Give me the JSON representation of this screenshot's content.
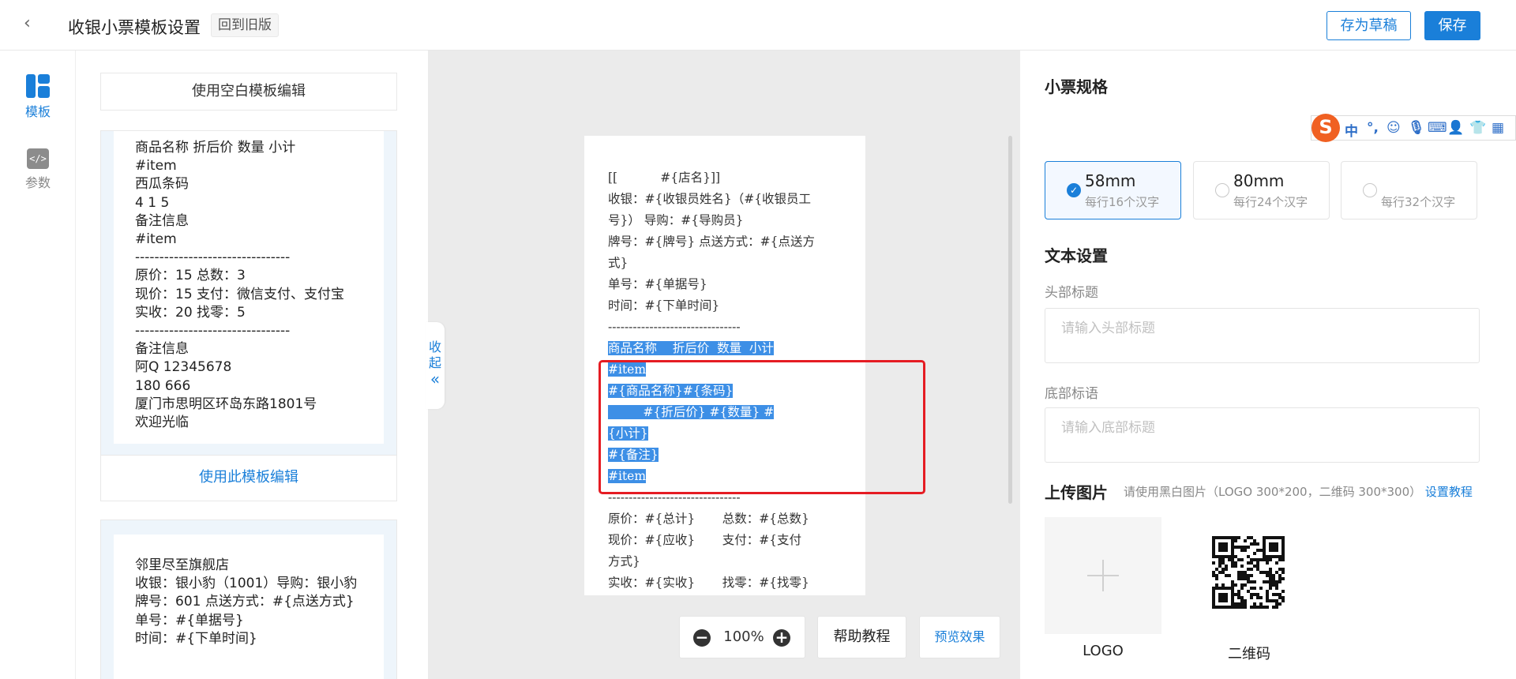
{
  "topbar": {
    "back_icon": "chevron-left-icon",
    "title": "收银小票模板设置",
    "old_version": "回到旧版",
    "draft_button": "存为草稿",
    "save_button": "保存"
  },
  "nav": {
    "templates": {
      "label": "模板",
      "icon": "grid-icon"
    },
    "params": {
      "label": "参数",
      "icon": "code-icon"
    }
  },
  "templates": {
    "blank_button": "使用空白模板编辑",
    "card1_lines": [
      "商品名称 折后价 数量 小计",
      "#item",
      "西瓜条码",
      "4 1 5",
      "备注信息",
      "#item",
      "--------------------------------",
      "原价：15 总数：3",
      "现价：15 支付：微信支付、支付宝",
      "实收：20 找零：5",
      "--------------------------------",
      "备注信息",
      "阿Q 12345678",
      "180 666",
      "厦门市思明区环岛东路1801号",
      "欢迎光临"
    ],
    "use_button": "使用此模板编辑",
    "card2_lines": [
      "邻里尽至旗舰店",
      "收银：银小豹（1001）导购：银小豹",
      "牌号：601 点送方式：#{点送方式}",
      "单号：#{单据号}",
      "时间：#{下单时间}"
    ]
  },
  "preview": {
    "collapse_label": "收起",
    "receipt_lines": [
      {
        "text": "[[           #{店名}]]",
        "hl": false
      },
      {
        "text": "收银：#{收银员姓名}（#{收银员工",
        "hl": false
      },
      {
        "text": "号}） 导购：#{导购员}",
        "hl": false
      },
      {
        "text": "牌号：#{牌号} 点送方式：#{点送方",
        "hl": false
      },
      {
        "text": "式}",
        "hl": false
      },
      {
        "text": "单号：#{单据号}",
        "hl": false
      },
      {
        "text": "时间：#{下单时间}",
        "hl": false
      },
      {
        "text": "--------------------------------",
        "hl": false
      },
      {
        "text": "商品名称    折后价  数量  小计",
        "hl": true
      },
      {
        "text": "#item",
        "hl": true
      },
      {
        "text": "#{商品名称}#{条码}",
        "hl": true
      },
      {
        "text": "         #{折后价} #{数量} #",
        "hl": true
      },
      {
        "text": "{小计}",
        "hl": true
      },
      {
        "text": "#{备注}",
        "hl": true
      },
      {
        "text": "#item",
        "hl": true
      },
      {
        "text": "--------------------------------",
        "hl": false
      },
      {
        "text": "原价：#{总计}       总数：#{总数}",
        "hl": false
      },
      {
        "text": "现价：#{应收}       支付：#{支付",
        "hl": false
      },
      {
        "text": "方式}",
        "hl": false
      },
      {
        "text": "实收：#{实收}       找零：#{找零}",
        "hl": false
      }
    ],
    "zoom": "100%",
    "help_button": "帮助教程",
    "preview_button": "预览效果"
  },
  "settings": {
    "spec_title": "小票规格",
    "specs": [
      {
        "name": "58mm",
        "sub": "每行16个汉字",
        "selected": true
      },
      {
        "name": "80mm",
        "sub": "每行24个汉字",
        "selected": false
      },
      {
        "name": "",
        "sub": "每行32个汉字",
        "selected": false
      }
    ],
    "text_title": "文本设置",
    "header_label": "头部标题",
    "header_placeholder": "请输入头部标题",
    "footer_label": "底部标语",
    "footer_placeholder": "请输入底部标题",
    "upload_title": "上传图片",
    "upload_tip": "请使用黑白图片（LOGO 300*200，二维码 300*300）",
    "upload_link": "设置教程",
    "logo_label": "LOGO",
    "qr_label": "二维码"
  },
  "ime": {
    "logo": "S",
    "lang": "中"
  },
  "colors": {
    "accent": "#1a7fd9",
    "highlight": "#3d8fe6",
    "red_box": "#e51c23"
  }
}
